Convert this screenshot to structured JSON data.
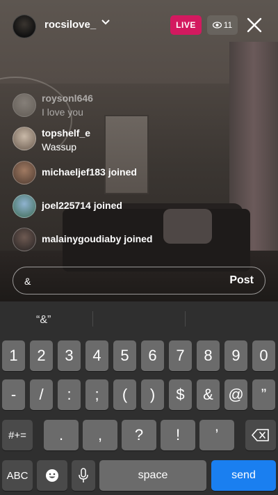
{
  "header": {
    "username": "rocsilove_",
    "live_label": "LIVE",
    "viewer_count": "11"
  },
  "comments": [
    {
      "user": "roysonl646",
      "text": "I love you"
    },
    {
      "user": "topshelf_e",
      "text": "Wassup"
    }
  ],
  "joins": [
    {
      "text": "michaeljef183 joined"
    },
    {
      "text": "joel225714 joined"
    },
    {
      "text": "malainygoudiaby joined"
    }
  ],
  "comment_box": {
    "value": "&",
    "post_label": "Post"
  },
  "keyboard": {
    "prediction": "“&”",
    "row1": [
      "1",
      "2",
      "3",
      "4",
      "5",
      "6",
      "7",
      "8",
      "9",
      "0"
    ],
    "row2": [
      "-",
      "/",
      ":",
      ";",
      "(",
      ")",
      "$",
      "&",
      "@",
      "”"
    ],
    "row3_left": "#+=",
    "row3": [
      ".",
      ",",
      "?",
      "!",
      "’"
    ],
    "abc_label": "ABC",
    "space_label": "space",
    "send_label": "send",
    "accent_color": "#1a7ff0"
  }
}
